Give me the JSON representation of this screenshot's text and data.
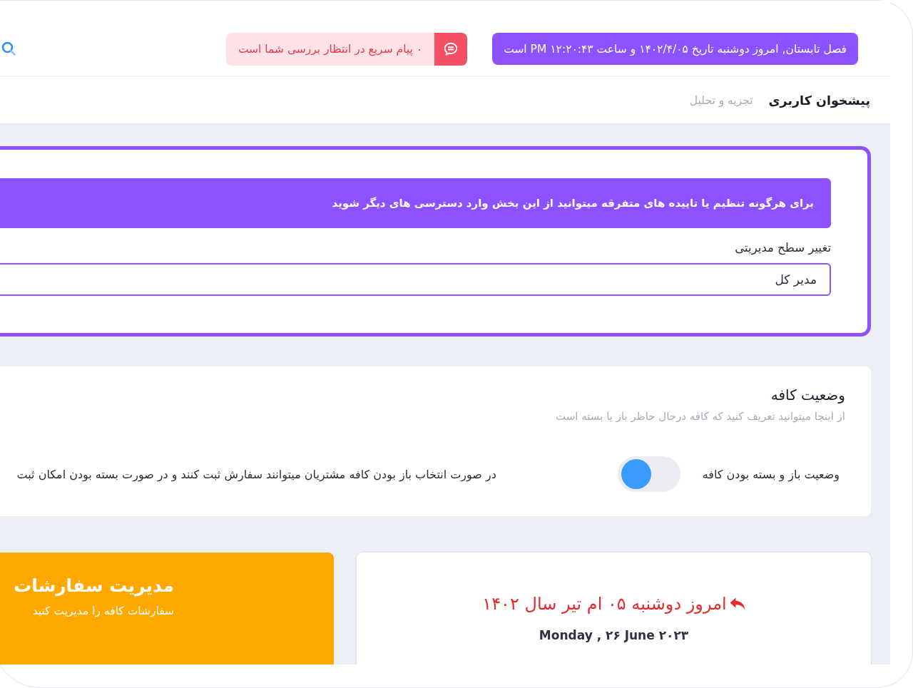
{
  "header": {
    "date_banner": "فصل تابستان, امروز دوشنبه تاریخ ۱۴۰۲/۴/۰۵ و ساعت ۱۲:۲۰:۴۳ PM است",
    "notification": "۰ پیام سریع در انتظار بررسی شما است"
  },
  "breadcrumb": {
    "title": "پیشخوان کاربری",
    "link": "تجزیه و تحلیل"
  },
  "settings_card": {
    "banner": "برای هرگونه تنظیم یا تاییده های متفرقه میتوانید از این بخش وارد دسترسی های دیگر شوید",
    "field_label": "تغییر سطح مدیریتی",
    "field_value": "مدیر کل"
  },
  "cafe_status": {
    "title": "وضعیت کافه",
    "subtitle": "از اینجا میتوانید تعریف کنید که کافه درحال حاظر باز یا بسته است",
    "toggle": {
      "label": "وضعیت باز و بسته بودن کافه",
      "on": true
    },
    "description": "در صورت انتخاب باز بودن کافه مشتریان میتوانند سفارش ثبت کنند و در صورت بسته بودن امکان ثبت"
  },
  "date_card": {
    "persian_date": "امروز دوشنبه ۰۵ ام تیر سال ۱۴۰۲",
    "gregorian_date": "Monday , ۲۶ June ۲۰۲۳"
  },
  "orders_card": {
    "title": "مدیریت سفارشات",
    "subtitle": "سفارشات کافه را مدیریت کنید"
  }
}
